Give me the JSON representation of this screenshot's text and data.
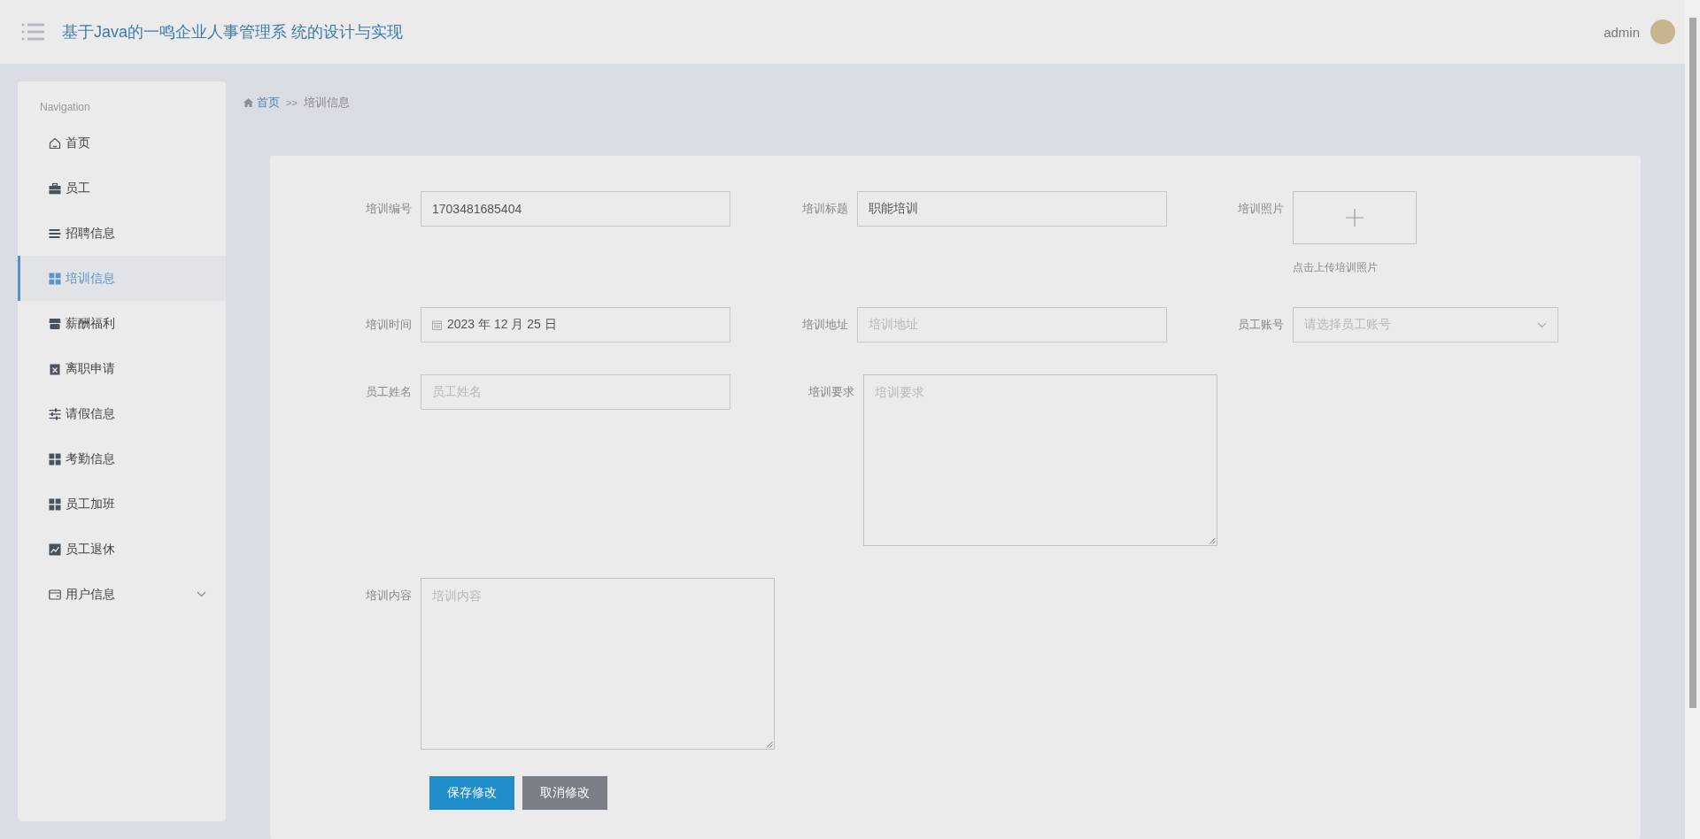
{
  "header": {
    "title": "基于Java的一鸣企业人事管理系 统的设计与实现",
    "user": "admin"
  },
  "sidebar": {
    "heading": "Navigation",
    "items": [
      {
        "label": "首页",
        "selected": false,
        "expandable": false
      },
      {
        "label": "员工",
        "selected": false,
        "expandable": false
      },
      {
        "label": "招聘信息",
        "selected": false,
        "expandable": false
      },
      {
        "label": "培训信息",
        "selected": true,
        "expandable": false
      },
      {
        "label": "薪酬福利",
        "selected": false,
        "expandable": false
      },
      {
        "label": "离职申请",
        "selected": false,
        "expandable": false
      },
      {
        "label": "请假信息",
        "selected": false,
        "expandable": false
      },
      {
        "label": "考勤信息",
        "selected": false,
        "expandable": false
      },
      {
        "label": "员工加班",
        "selected": false,
        "expandable": false
      },
      {
        "label": "员工退休",
        "selected": false,
        "expandable": false
      },
      {
        "label": "用户信息",
        "selected": false,
        "expandable": true
      }
    ]
  },
  "breadcrumb": {
    "home": "首页",
    "separator": ">>",
    "current": "培训信息"
  },
  "form": {
    "rows": [
      [
        {
          "kind": "text",
          "label": "培训编号",
          "value": "1703481685404"
        },
        {
          "kind": "text",
          "label": "培训标题",
          "value": "职能培训"
        },
        {
          "kind": "upload",
          "label": "培训照片",
          "hint": "点击上传培训照片"
        }
      ],
      [
        {
          "kind": "date",
          "label": "培训时间",
          "value": "2023 年 12 月 25 日"
        },
        {
          "kind": "text",
          "label": "培训地址",
          "placeholder": "培训地址"
        },
        {
          "kind": "select",
          "label": "员工账号",
          "placeholder": "请选择员工账号"
        }
      ],
      [
        {
          "kind": "text",
          "label": "员工姓名",
          "placeholder": "员工姓名"
        },
        {
          "kind": "textarea",
          "label": "培训要求",
          "placeholder": "培训要求"
        }
      ],
      [
        {
          "kind": "textarea",
          "label": "培训内容",
          "placeholder": "培训内容"
        }
      ]
    ],
    "buttons": [
      {
        "label": "保存修改",
        "kind": "primary"
      },
      {
        "label": "取消修改",
        "kind": "secondary"
      }
    ]
  }
}
